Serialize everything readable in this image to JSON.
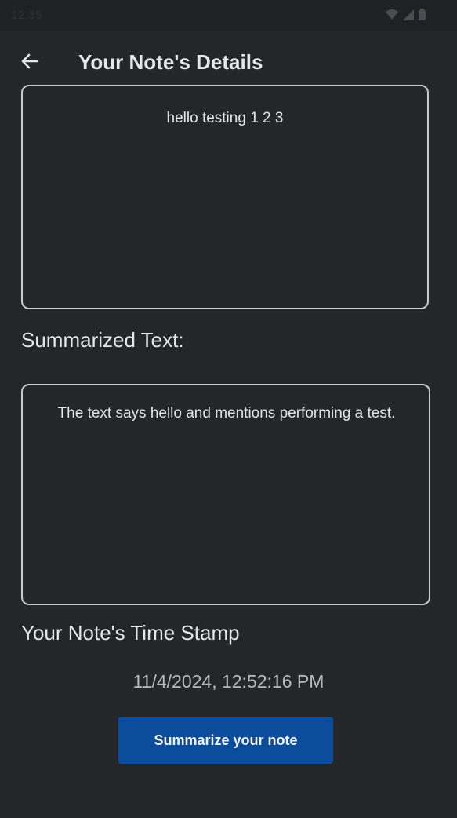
{
  "status_bar": {
    "time": "12:35",
    "icons": [
      "wifi-icon",
      "signal-icon",
      "battery-icon"
    ]
  },
  "app_bar": {
    "back_icon": "arrow-left-icon",
    "title": "Your Note's Details"
  },
  "note": {
    "text": "hello testing 1 2 3"
  },
  "summary": {
    "label": "Summarized Text:",
    "text": "The text says hello and mentions performing a test."
  },
  "timestamp": {
    "label": "Your Note's Time Stamp",
    "value": "11/4/2024, 12:52:16 PM"
  },
  "actions": {
    "summarize_label": "Summarize your note"
  },
  "colors": {
    "background": "#24262a",
    "primary_button": "#0b4d9c",
    "border": "#c9cacd",
    "text": "#e6e7ea"
  }
}
